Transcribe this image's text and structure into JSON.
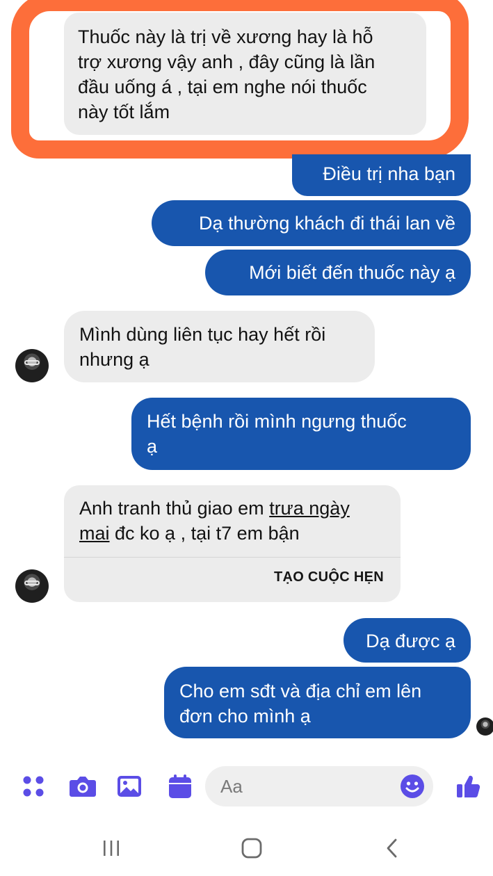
{
  "colors": {
    "outgoing_bubble": "#1856ae",
    "incoming_bubble": "#ececec",
    "highlight_ring": "#fd6e3a",
    "composer_accent": "#5b4de6",
    "nav_icons": "#6b6b6b"
  },
  "messages": [
    {
      "direction": "incoming",
      "highlighted": true,
      "lines": [
        "Thuốc này là trị về xương hay là hỗ",
        "trợ xương vậy anh , đây cũng là lần",
        "đầu uống á , tại em nghe nói thuốc",
        "này tốt lắm"
      ]
    },
    {
      "direction": "outgoing",
      "lines": [
        "Điều trị nha bạn"
      ]
    },
    {
      "direction": "outgoing",
      "lines": [
        "Dạ thường khách đi thái lan về"
      ]
    },
    {
      "direction": "outgoing",
      "lines": [
        "Mới biết đến thuốc này ạ"
      ]
    },
    {
      "direction": "incoming",
      "avatar": true,
      "lines": [
        "Mình dùng liên tục hay hết rồi",
        "nhưng ạ"
      ]
    },
    {
      "direction": "outgoing",
      "lines": [
        "Hết bệnh rồi mình ngưng thuốc",
        "ạ"
      ]
    },
    {
      "direction": "incoming",
      "avatar": true,
      "line1_plain": "Anh tranh thủ giao em ",
      "line1_link": "trưa ngày",
      "line2_link": "mai",
      "line2_plain": " đc ko ạ , tại t7 em bận",
      "action_label": "TẠO CUỘC HẸN"
    },
    {
      "direction": "outgoing",
      "lines": [
        "Dạ được ạ"
      ]
    },
    {
      "direction": "outgoing",
      "seen_avatar": true,
      "lines": [
        "Cho em sđt và địa chỉ em lên",
        "đơn cho mình ạ"
      ]
    }
  ],
  "composer": {
    "icons": [
      "menu-dots-icon",
      "camera-icon",
      "gallery-icon",
      "calendar-icon",
      "emoji-icon",
      "thumbs-up-icon"
    ],
    "placeholder": "Aa"
  },
  "navbar": {
    "icons": [
      "recents-icon",
      "home-icon",
      "back-icon"
    ]
  }
}
